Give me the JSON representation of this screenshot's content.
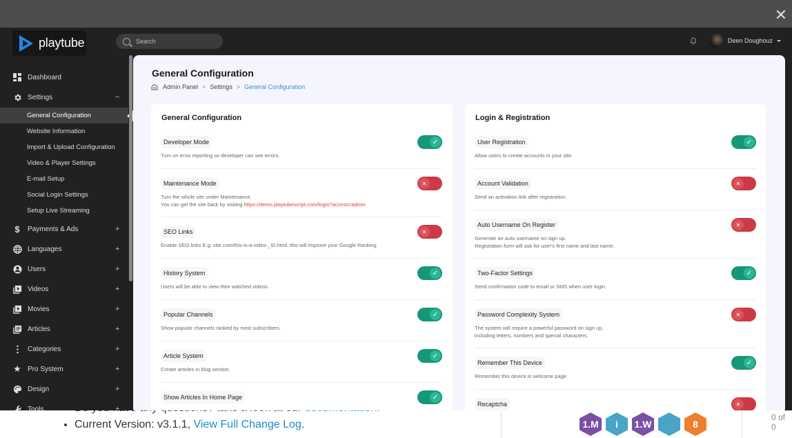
{
  "underlying": {
    "bullets": [
      {
        "text": "Do you have any questions? take a look at our ",
        "link": "documentation."
      },
      {
        "text": "Current Version: v3.1.1, ",
        "link": "View Full Change Log",
        "suffix": "."
      }
    ],
    "badges": [
      {
        "name": "rocket-badge-1m",
        "label": "1.M",
        "color": "#7b4fa3"
      },
      {
        "name": "info-badge",
        "label": "i",
        "color": "#4aa3c9"
      },
      {
        "name": "rocket-badge-1w",
        "label": "1.W",
        "color": "#7b4fa3"
      },
      {
        "name": "document-badge",
        "label": "",
        "color": "#4aa3c9"
      },
      {
        "name": "number-badge",
        "label": "8",
        "color": "#ef7e2f"
      }
    ],
    "counter": "0 of 0"
  },
  "overlay": {
    "close_label": "✕"
  },
  "app": {
    "logo_text": "playtube",
    "search_placeholder": "Search",
    "user_name": "Deen Doughouz"
  },
  "sidebar": {
    "items": [
      {
        "label": "Dashboard",
        "icon": "dashboard-icon",
        "toggle": ""
      },
      {
        "label": "Settings",
        "icon": "gear-icon",
        "toggle": "−"
      },
      {
        "label": "Payments & Ads",
        "icon": "dollar-icon",
        "toggle": "+"
      },
      {
        "label": "Languages",
        "icon": "globe-icon",
        "toggle": "+"
      },
      {
        "label": "Users",
        "icon": "user-circle-icon",
        "toggle": "+"
      },
      {
        "label": "Videos",
        "icon": "video-library-icon",
        "toggle": "+"
      },
      {
        "label": "Movies",
        "icon": "movie-library-icon",
        "toggle": "+"
      },
      {
        "label": "Articles",
        "icon": "articles-icon",
        "toggle": "+"
      },
      {
        "label": "Categories",
        "icon": "more-vertical-icon",
        "toggle": "+"
      },
      {
        "label": "Pro System",
        "icon": "star-icon",
        "toggle": "+"
      },
      {
        "label": "Design",
        "icon": "palette-icon",
        "toggle": "+"
      },
      {
        "label": "Tools",
        "icon": "wrench-icon",
        "toggle": "+"
      }
    ],
    "settings_sub": [
      {
        "label": "General Configuration",
        "active": true
      },
      {
        "label": "Website Information",
        "active": false
      },
      {
        "label": "Import & Upload Configuration",
        "active": false
      },
      {
        "label": "Video & Player Settings",
        "active": false
      },
      {
        "label": "E-mail Setup",
        "active": false
      },
      {
        "label": "Social Login Settings",
        "active": false
      },
      {
        "label": "Setup Live Streaming",
        "active": false
      }
    ]
  },
  "main": {
    "title": "General Configuration",
    "breadcrumb": [
      "Admin Panel",
      "Settings",
      "General Configuration"
    ],
    "breadcrumb_sep": ">",
    "general": {
      "title": "General Configuration",
      "settings": [
        {
          "label": "Developer Mode",
          "desc": [
            "Turn on error reporting so developer can see errors."
          ],
          "enabled": true
        },
        {
          "label": "Maintenance Mode",
          "desc": [
            "Turn the whole site under Maintenance.",
            "You can get the site back by visiting "
          ],
          "link": "https://demo.playtubescript.com/login?access=admin",
          "enabled": false
        },
        {
          "label": "SEO Links",
          "desc": [
            "Enable SEO links E.g: site.com/this-is-a-video-_ID.html, this will improve your Google Ranking"
          ],
          "enabled": false
        },
        {
          "label": "History System",
          "desc": [
            "Users will be able to view their watched videos."
          ],
          "enabled": true
        },
        {
          "label": "Popular Channels",
          "desc": [
            "Show popular channels ranked by most subscribers."
          ],
          "enabled": true
        },
        {
          "label": "Article System",
          "desc": [
            "Create articles in blog section."
          ],
          "enabled": true
        },
        {
          "label": "Show Articles In Home Page",
          "desc": [],
          "enabled": true
        }
      ]
    },
    "login": {
      "title": "Login & Registration",
      "settings": [
        {
          "label": "User Registration",
          "desc": [
            "Allow users to create accounts in your site."
          ],
          "enabled": true
        },
        {
          "label": "Account Validation",
          "desc": [
            "Send an activation link after registration."
          ],
          "enabled": false
        },
        {
          "label": "Auto Username On Register",
          "desc": [
            "Generate an auto username on sign up.",
            "Registration form will ask for user's first name and last name."
          ],
          "enabled": false
        },
        {
          "label": "Two-Factor Settings",
          "desc": [
            "Send confirmation code to email or SMS when user login."
          ],
          "enabled": true
        },
        {
          "label": "Password Complexity System",
          "desc": [
            "The system will require a powerful password on sign up,",
            "including letters, numbers and special characters."
          ],
          "enabled": false
        },
        {
          "label": "Remember This Device",
          "desc": [
            "Remember this device in welcome page."
          ],
          "enabled": true
        },
        {
          "label": "Recaptcha",
          "desc": [],
          "enabled": false
        }
      ]
    }
  }
}
